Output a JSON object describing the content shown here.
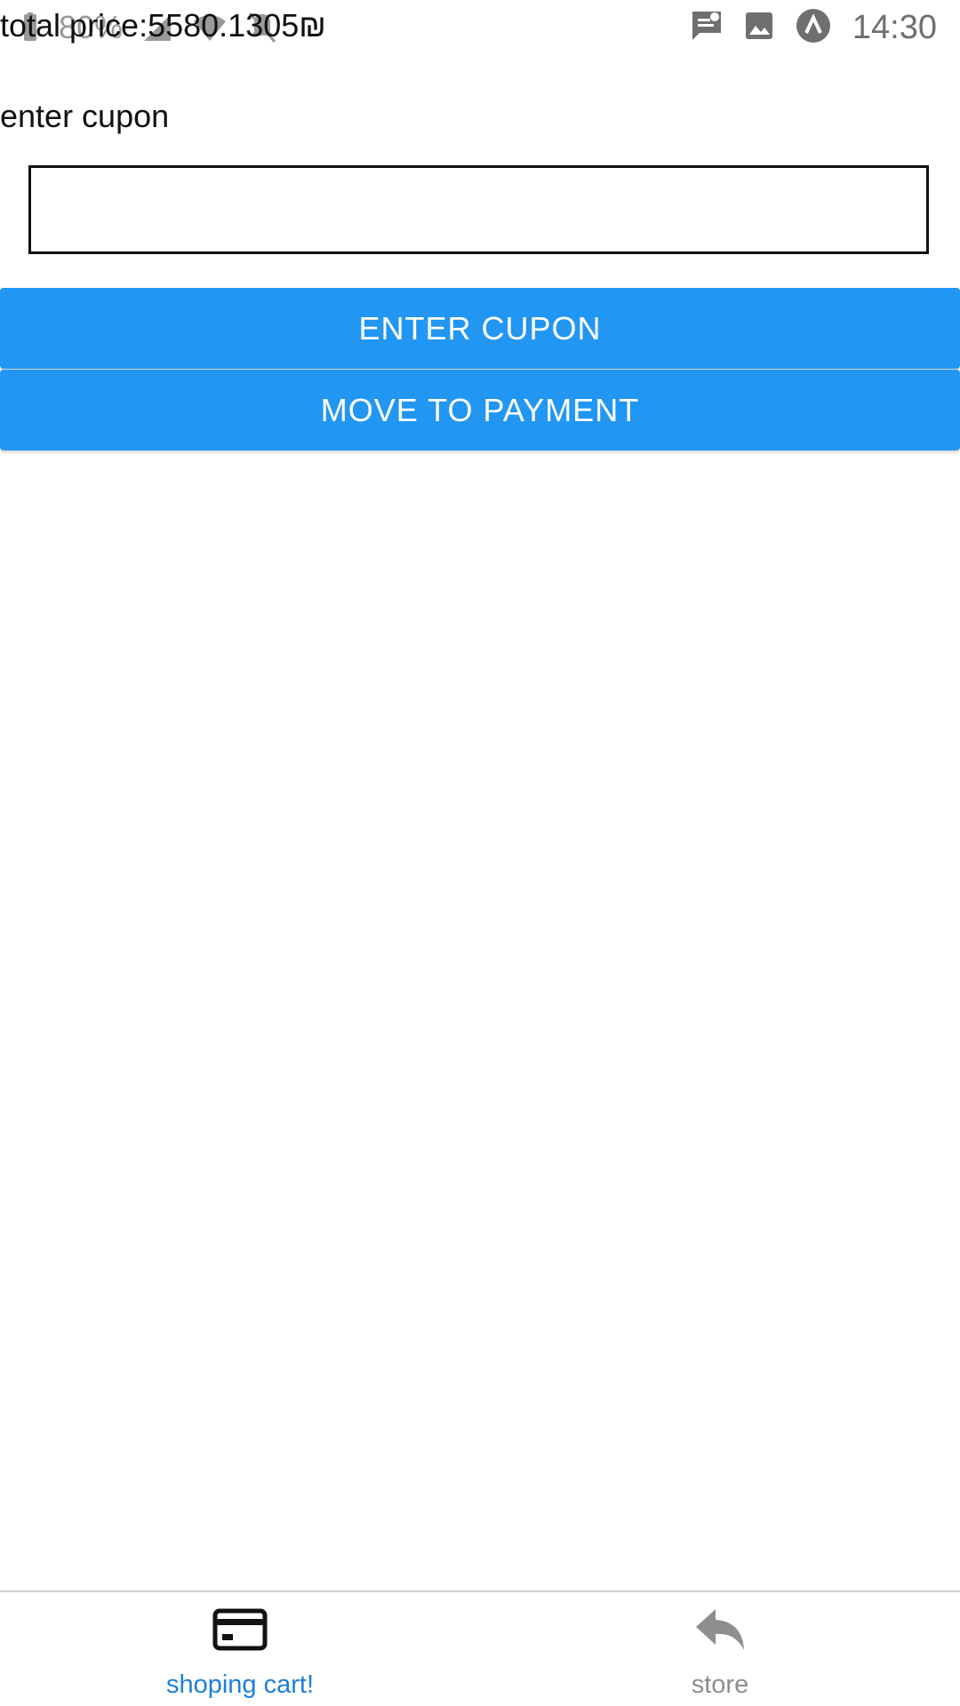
{
  "status_bar": {
    "battery": "80%",
    "time": "14:30"
  },
  "cart": {
    "total_price": "total price:5580.1305₪"
  },
  "coupon": {
    "label": "enter cupon",
    "input_value": "",
    "enter_button": "ENTER CUPON",
    "payment_button": "MOVE TO PAYMENT"
  },
  "tabs": [
    {
      "label": "shoping cart!",
      "icon": "credit-card-icon",
      "active": true
    },
    {
      "label": "store",
      "icon": "reply-arrow-icon",
      "active": false
    }
  ],
  "colors": {
    "primary_button": "#2196f3",
    "active_tab": "#1e7fd8",
    "inactive_tab": "#8e8e8e"
  }
}
